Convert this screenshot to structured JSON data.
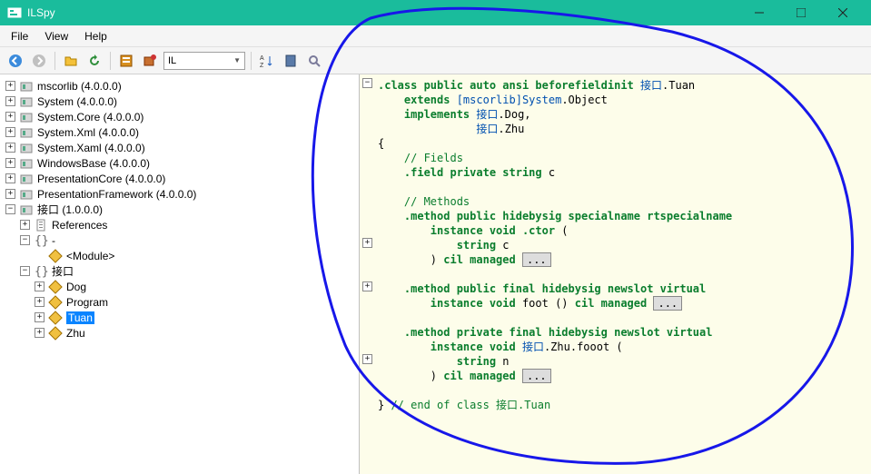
{
  "window": {
    "title": "ILSpy"
  },
  "menu": {
    "items": [
      "File",
      "View",
      "Help"
    ]
  },
  "toolbar": {
    "language_label": "IL"
  },
  "tree": {
    "top": [
      "mscorlib (4.0.0.0)",
      "System (4.0.0.0)",
      "System.Core (4.0.0.0)",
      "System.Xml (4.0.0.0)",
      "System.Xaml (4.0.0.0)",
      "WindowsBase (4.0.0.0)",
      "PresentationCore (4.0.0.0)",
      "PresentationFramework (4.0.0.0)"
    ],
    "open_asm": "接口 (1.0.0.0)",
    "references": "References",
    "dash": "-",
    "module": "<Module>",
    "ns": "接口",
    "classes": [
      "Dog",
      "Program",
      "Tuan",
      "Zhu"
    ]
  },
  "code": {
    "l1a": ".class",
    "l1b": " public auto ansi beforefieldinit",
    "l1c": " 接口",
    "l1d": ".Tuan",
    "l2a": "extends",
    "l2b": " [mscorlib]System",
    "l2c": ".Object",
    "l3a": "implements",
    "l3b": " 接口",
    "l3c": ".Dog,",
    "l4a": "接口",
    "l4b": ".Zhu",
    "l5": "{",
    "l6": "// Fields",
    "l7a": ".field",
    "l7b": " private string",
    "l7c": " c",
    "l9": "// Methods",
    "l10a": ".method",
    "l10b": " public hidebysig specialname rtspecialname",
    "l11a": "instance",
    "l11b": " void",
    "l11c": " .ctor",
    "l11d": " (",
    "l12a": "string",
    "l12b": " c",
    "l13a": ") ",
    "l13b": "cil managed",
    "l13c": "...",
    "l15a": ".method",
    "l15b": " public final hidebysig newslot virtual",
    "l16a": "instance",
    "l16b": " void",
    "l16c": " foot",
    "l16d": " () ",
    "l16e": "cil managed",
    "l16f": "...",
    "l18a": ".method",
    "l18b": " private final hidebysig newslot virtual",
    "l19a": "instance",
    "l19b": " void",
    "l19c": " 接口",
    "l19d": ".Zhu.fooot (",
    "l20a": "string",
    "l20b": " n",
    "l21a": ") ",
    "l21b": "cil managed",
    "l21c": "...",
    "l23": "} ",
    "l23b": "// end of class 接口.Tuan"
  }
}
